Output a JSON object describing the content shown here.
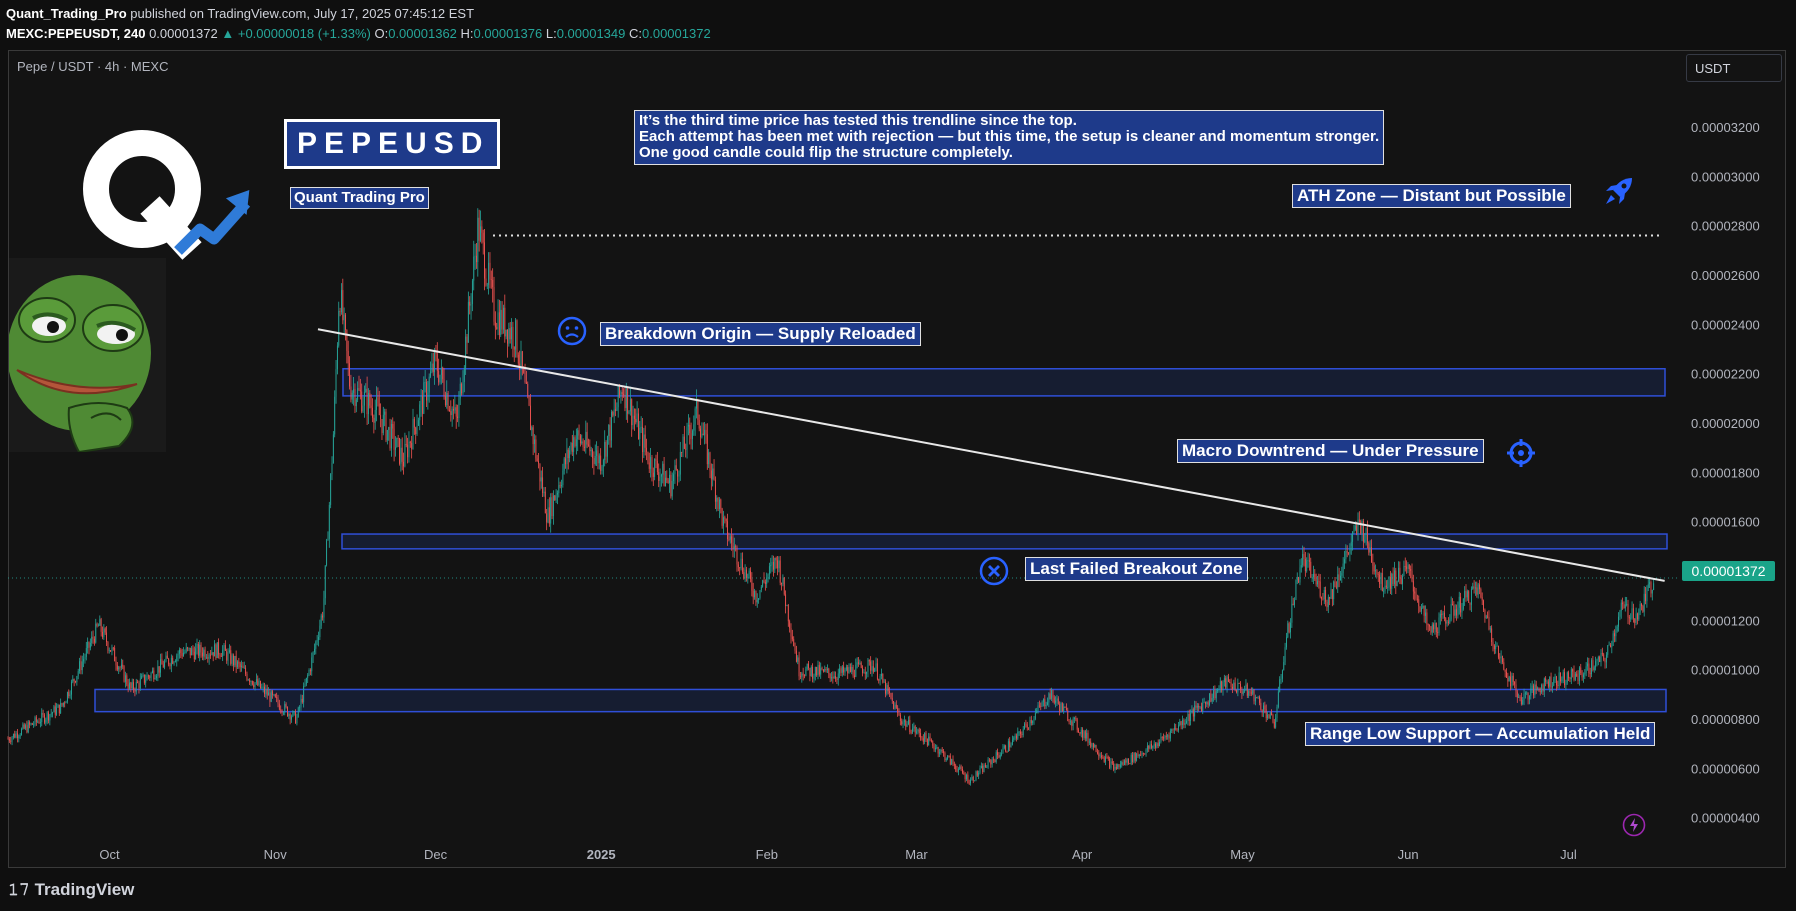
{
  "header": {
    "author": "Quant_Trading_Pro",
    "published_text": "published on TradingView.com, July 17, 2025 07:45:12 EST",
    "symbol": "MEXC:PEPEUSDT, 240",
    "last": "0.00001372",
    "change": "▲ +0.00000018 (+1.33%)",
    "o_label": "O:",
    "o": "0.00001362",
    "h_label": "H:",
    "h": "0.00001376",
    "l_label": "L:",
    "l": "0.00001349",
    "c_label": "C:",
    "c": "0.00001372"
  },
  "chart_title": "Pepe / USDT · 4h · MEXC",
  "currency_button": "USDT",
  "last_price_tag": "0.00001372",
  "annotations": {
    "title_box": "PEPEUSD",
    "brand": "Quant Trading Pro",
    "note_line1": "It’s the third time price has tested this trendline since the top.",
    "note_line2": "Each attempt has been met with rejection — but this time, the setup is cleaner and momentum stronger.",
    "note_line3": "One good candle could flip the structure completely.",
    "ath": "ATH Zone — Distant but Possible",
    "breakdown": "Breakdown Origin — Supply Reloaded",
    "macro": "Macro Downtrend — Under Pressure",
    "failed": "Last Failed Breakout Zone",
    "range_low": "Range Low Support — Accumulation Held"
  },
  "footer": {
    "brand": "TradingView"
  },
  "icons": [
    "sad-face-icon",
    "x-circle-icon",
    "target-icon",
    "rocket-icon",
    "lightning-icon",
    "q-logo-icon",
    "trend-arrow-icon",
    "pepe-frog-icon"
  ],
  "colors": {
    "up": "#26a69a",
    "down": "#ef5350",
    "zone": "#1e3a8a",
    "zone_border": "#2f4fd8",
    "accent": "#2962ff",
    "price_tag": "#1aa489"
  },
  "chart_data": {
    "type": "candlestick",
    "title": "Pepe / USDT · 4h · MEXC",
    "x_ticks": [
      "Oct",
      "Nov",
      "Dec",
      "2025",
      "Feb",
      "Mar",
      "Apr",
      "May",
      "Jun",
      "Jul"
    ],
    "y_ticks": [
      "0.00003200",
      "0.00003000",
      "0.00002800",
      "0.00002600",
      "0.00002400",
      "0.00002200",
      "0.00002000",
      "0.00001800",
      "0.00001600",
      "0.00001400",
      "0.00001200",
      "0.00001000",
      "0.00000800",
      "0.00000600",
      "0.00000400"
    ],
    "ylim": [
      3.3e-06,
      3.35e-05
    ],
    "x_range": [
      "2024-09-12",
      "2025-07-20"
    ],
    "last_price": 1.372e-05,
    "zones": [
      {
        "from": 2.11e-05,
        "to": 2.22e-05
      },
      {
        "from": 1.49e-05,
        "to": 1.55e-05
      },
      {
        "from": 8.3e-06,
        "to": 9.2e-06
      }
    ],
    "ath_level": 2.76e-05,
    "trendline": [
      {
        "date": "2024-11-09",
        "price": 2.38e-05
      },
      {
        "date": "2025-07-19",
        "price": 1.36e-05
      }
    ],
    "price_path": [
      [
        "2024-09-12",
        7.2e-06
      ],
      [
        "2024-09-22",
        8.5e-06
      ],
      [
        "2024-09-29",
        1.18e-05
      ],
      [
        "2024-10-05",
        9.2e-06
      ],
      [
        "2024-10-14",
        1.07e-05
      ],
      [
        "2024-10-22",
        1.08e-05
      ],
      [
        "2024-10-30",
        9.1e-06
      ],
      [
        "2024-11-05",
        8e-06
      ],
      [
        "2024-11-08",
        1.05e-05
      ],
      [
        "2024-11-10",
        1.25e-05
      ],
      [
        "2024-11-12",
        2e-05
      ],
      [
        "2024-11-13",
        2.55e-05
      ],
      [
        "2024-11-15",
        2.15e-05
      ],
      [
        "2024-11-20",
        2.05e-05
      ],
      [
        "2024-11-25",
        1.85e-05
      ],
      [
        "2024-12-01",
        2.25e-05
      ],
      [
        "2024-12-05",
        2e-05
      ],
      [
        "2024-12-09",
        2.8e-05
      ],
      [
        "2024-12-12",
        2.45e-05
      ],
      [
        "2024-12-16",
        2.35e-05
      ],
      [
        "2024-12-20",
        1.85e-05
      ],
      [
        "2024-12-22",
        1.62e-05
      ],
      [
        "2024-12-27",
        1.95e-05
      ],
      [
        "2025-01-01",
        1.85e-05
      ],
      [
        "2025-01-05",
        2.15e-05
      ],
      [
        "2025-01-10",
        1.85e-05
      ],
      [
        "2025-01-14",
        1.75e-05
      ],
      [
        "2025-01-19",
        2.05e-05
      ],
      [
        "2025-01-24",
        1.58e-05
      ],
      [
        "2025-01-30",
        1.3e-05
      ],
      [
        "2025-02-03",
        1.45e-05
      ],
      [
        "2025-02-07",
        1e-05
      ],
      [
        "2025-02-14",
        9.8e-06
      ],
      [
        "2025-02-21",
        1.02e-05
      ],
      [
        "2025-02-26",
        8e-06
      ],
      [
        "2025-03-05",
        6.8e-06
      ],
      [
        "2025-03-11",
        5.5e-06
      ],
      [
        "2025-03-20",
        7.3e-06
      ],
      [
        "2025-03-26",
        9e-06
      ],
      [
        "2025-04-02",
        7.2e-06
      ],
      [
        "2025-04-07",
        6e-06
      ],
      [
        "2025-04-15",
        7e-06
      ],
      [
        "2025-04-23",
        8.5e-06
      ],
      [
        "2025-04-28",
        9.5e-06
      ],
      [
        "2025-05-03",
        9e-06
      ],
      [
        "2025-05-07",
        7.8e-06
      ],
      [
        "2025-05-09",
        1.1e-05
      ],
      [
        "2025-05-12",
        1.45e-05
      ],
      [
        "2025-05-17",
        1.28e-05
      ],
      [
        "2025-05-23",
        1.6e-05
      ],
      [
        "2025-05-27",
        1.35e-05
      ],
      [
        "2025-06-01",
        1.4e-05
      ],
      [
        "2025-06-05",
        1.15e-05
      ],
      [
        "2025-06-10",
        1.25e-05
      ],
      [
        "2025-06-14",
        1.33e-05
      ],
      [
        "2025-06-18",
        1.05e-05
      ],
      [
        "2025-06-22",
        8.8e-06
      ],
      [
        "2025-06-27",
        9.5e-06
      ],
      [
        "2025-07-03",
        9.8e-06
      ],
      [
        "2025-07-08",
        1.05e-05
      ],
      [
        "2025-07-11",
        1.25e-05
      ],
      [
        "2025-07-14",
        1.22e-05
      ],
      [
        "2025-07-17",
        1.37e-05
      ]
    ]
  }
}
